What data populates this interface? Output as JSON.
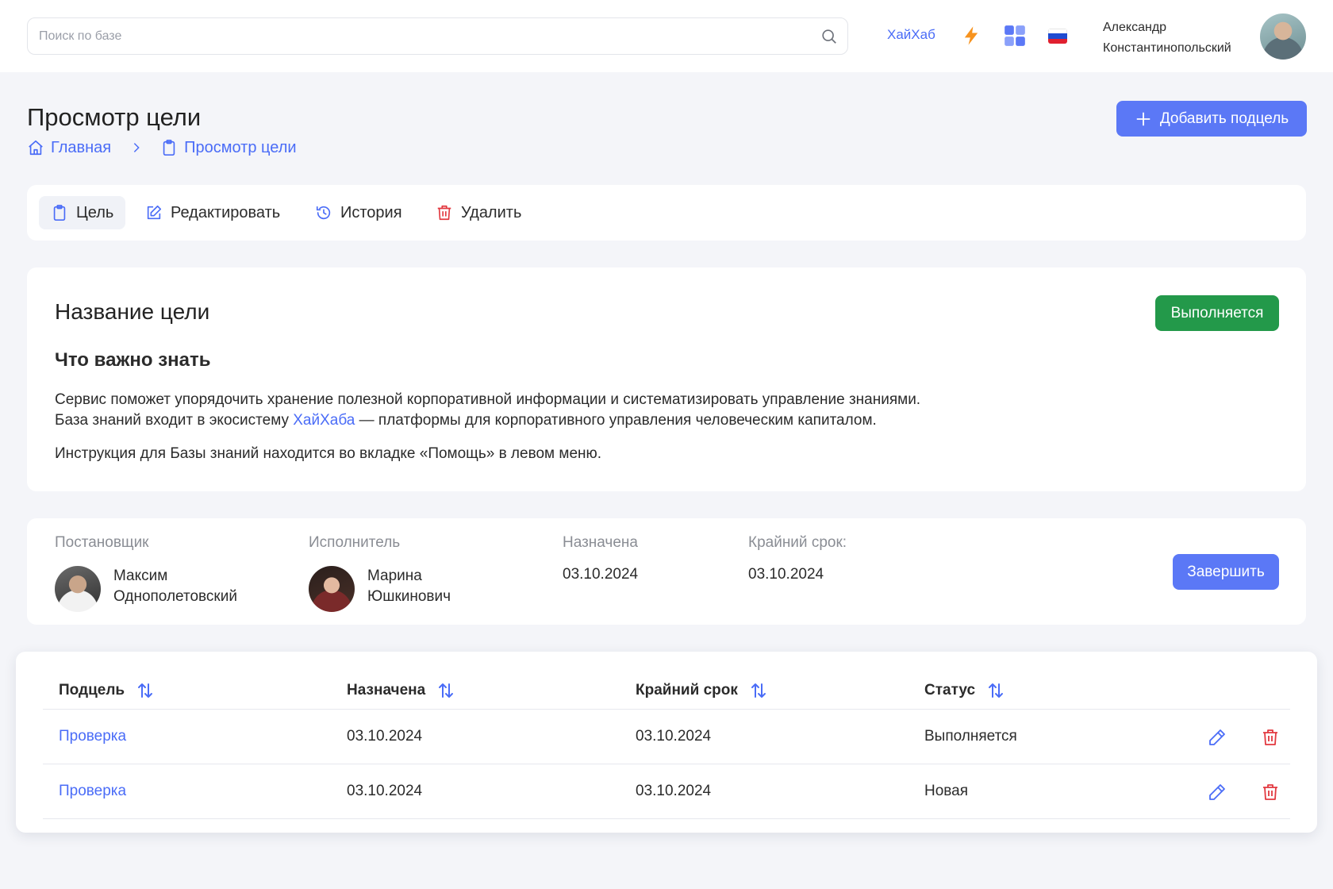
{
  "header": {
    "search_placeholder": "Поиск по базе",
    "brand_link": "ХайХаб",
    "user_name_line1": "Александр",
    "user_name_line2": "Константинопольский",
    "icons": [
      "search-icon",
      "lightning-icon",
      "apps-grid-icon",
      "russia-flag-icon"
    ],
    "colors": {
      "accent": "#4a6cf7",
      "lightning": "#f7931e",
      "grid": "#5b78f6"
    }
  },
  "page": {
    "title": "Просмотр цели",
    "breadcrumb": [
      {
        "label": "Главная",
        "icon": "home-icon"
      },
      {
        "label": "Просмотр цели",
        "icon": "clipboard-icon"
      }
    ],
    "add_button": "Добавить подцель"
  },
  "tabs": [
    {
      "label": "Цель",
      "icon": "clipboard-icon",
      "active": true
    },
    {
      "label": "Редактировать",
      "icon": "edit-icon",
      "active": false
    },
    {
      "label": "История",
      "icon": "history-icon",
      "active": false
    },
    {
      "label": "Удалить",
      "icon": "trash-icon",
      "active": false
    }
  ],
  "goal": {
    "title": "Название цели",
    "status": "Выполняется",
    "status_color": "#23994a",
    "section_title": "Что важно знать",
    "para1": "Сервис поможет упорядочить хранение полезной корпоративной информации и систематизировать управление знаниями.",
    "para2_before": "База знаний входит в экосистему ",
    "para2_link": "ХайХаба",
    "para2_after": " — платформы для корпоративного управления человеческим капиталом.",
    "para3": "Инструкция для Базы знаний находится во вкладке «Помощь» в левом меню."
  },
  "people": {
    "assigner_label": "Постановщик",
    "assigner_line1": "Максим",
    "assigner_line2": "Однополетовский",
    "executor_label": "Исполнитель",
    "executor_line1": "Марина",
    "executor_line2": "Юшкинович",
    "assigned_label": "Назначена",
    "assigned_value": "03.10.2024",
    "deadline_label": "Крайний срок:",
    "deadline_value": "03.10.2024",
    "finish_button": "Завершить"
  },
  "subgoals": {
    "columns": [
      "Подцель",
      "Назначена",
      "Крайний срок",
      "Статус"
    ],
    "rows": [
      {
        "name": "Проверка",
        "assigned": "03.10.2024",
        "deadline": "03.10.2024",
        "status": "Выполняется"
      },
      {
        "name": "Проверка",
        "assigned": "03.10.2024",
        "deadline": "03.10.2024",
        "status": "Новая"
      }
    ]
  }
}
